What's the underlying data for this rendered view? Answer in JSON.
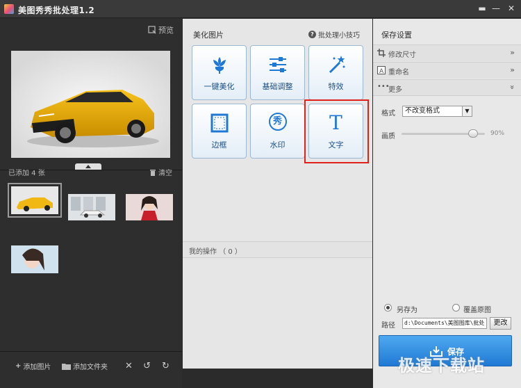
{
  "window": {
    "title": "美图秀秀批处理1.2",
    "minimize_icon": "minimize-icon",
    "close_icon": "close-icon"
  },
  "left_panel": {
    "preview_label": "预览",
    "added_count": "已添加 4 张",
    "clear_label": "清空",
    "toolbar": {
      "add_image": "添加图片",
      "add_folder": "添加文件夹"
    }
  },
  "middle_panel": {
    "title": "美化图片",
    "tips": "批处理小技巧",
    "tiles": [
      {
        "label": "一键美化",
        "icon": "flower-icon"
      },
      {
        "label": "基础调整",
        "icon": "sliders-icon"
      },
      {
        "label": "特效",
        "icon": "magic-wand-icon"
      },
      {
        "label": "边框",
        "icon": "frame-icon"
      },
      {
        "label": "水印",
        "icon": "watermark-icon",
        "glyph": "秀"
      },
      {
        "label": "文字",
        "icon": "text-icon",
        "glyph": "T"
      }
    ],
    "operations_label": "我的操作 （ 0 ）"
  },
  "right_panel": {
    "title": "保存设置",
    "sections": [
      {
        "label": "修改尺寸",
        "chevron": "»"
      },
      {
        "label": "重命名",
        "chevron": "»"
      },
      {
        "label": "更多",
        "chevron": "»"
      }
    ],
    "format_label": "格式",
    "format_value": "不改变格式",
    "quality_label": "画质",
    "quality_value": "90%",
    "quality_level": 0.9,
    "save_as_label": "另存为",
    "overwrite_label": "覆盖原图",
    "path_label": "路径",
    "path_value": "d:\\Documents\\美图图库\\批处",
    "change_label": "更改",
    "save_label": "保存"
  },
  "watermark_text": "极速下载站",
  "colors": {
    "accent": "#1f79d4",
    "highlight": "#e0201a",
    "tile_text": "#1a4f86"
  }
}
